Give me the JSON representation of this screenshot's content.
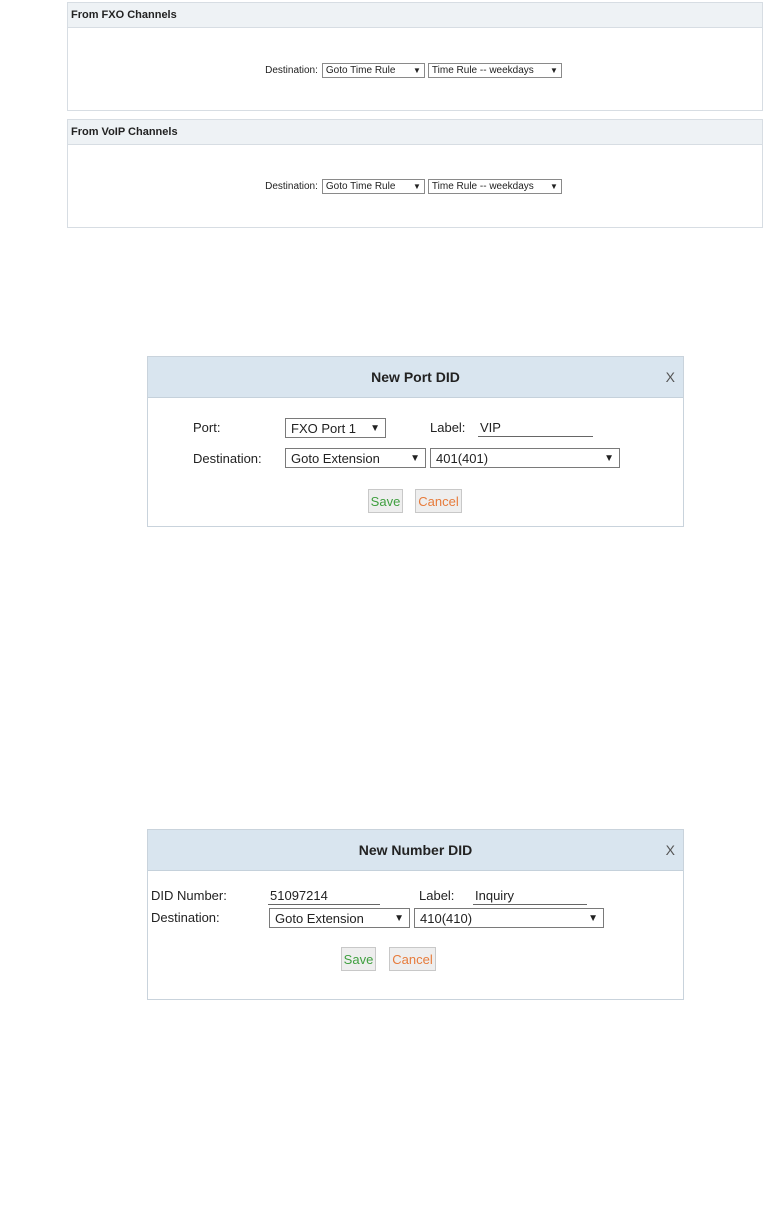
{
  "fxo": {
    "header": "From FXO Channels",
    "destination_label": "Destination:",
    "destination_type": "Goto Time Rule",
    "destination_target": "Time Rule -- weekdays"
  },
  "voip": {
    "header": "From VoIP Channels",
    "destination_label": "Destination:",
    "destination_type": "Goto Time Rule",
    "destination_target": "Time Rule -- weekdays"
  },
  "port_did": {
    "title": "New Port DID",
    "close": "X",
    "port_label": "Port:",
    "port_value": "FXO Port 1",
    "label_label": "Label:",
    "label_value": "VIP",
    "destination_label": "Destination:",
    "destination_type": "Goto Extension",
    "destination_target": "401(401)",
    "save": "Save",
    "cancel": "Cancel"
  },
  "number_did": {
    "title": "New Number DID",
    "close": "X",
    "did_label": "DID Number:",
    "did_value": "51097214",
    "label_label": "Label:",
    "label_value": "Inquiry",
    "destination_label": "Destination:",
    "destination_type": "Goto Extension",
    "destination_target": "410(410)",
    "save": "Save",
    "cancel": "Cancel"
  },
  "icons": {
    "dropdown": "chevron-down-icon",
    "close": "close-icon"
  }
}
